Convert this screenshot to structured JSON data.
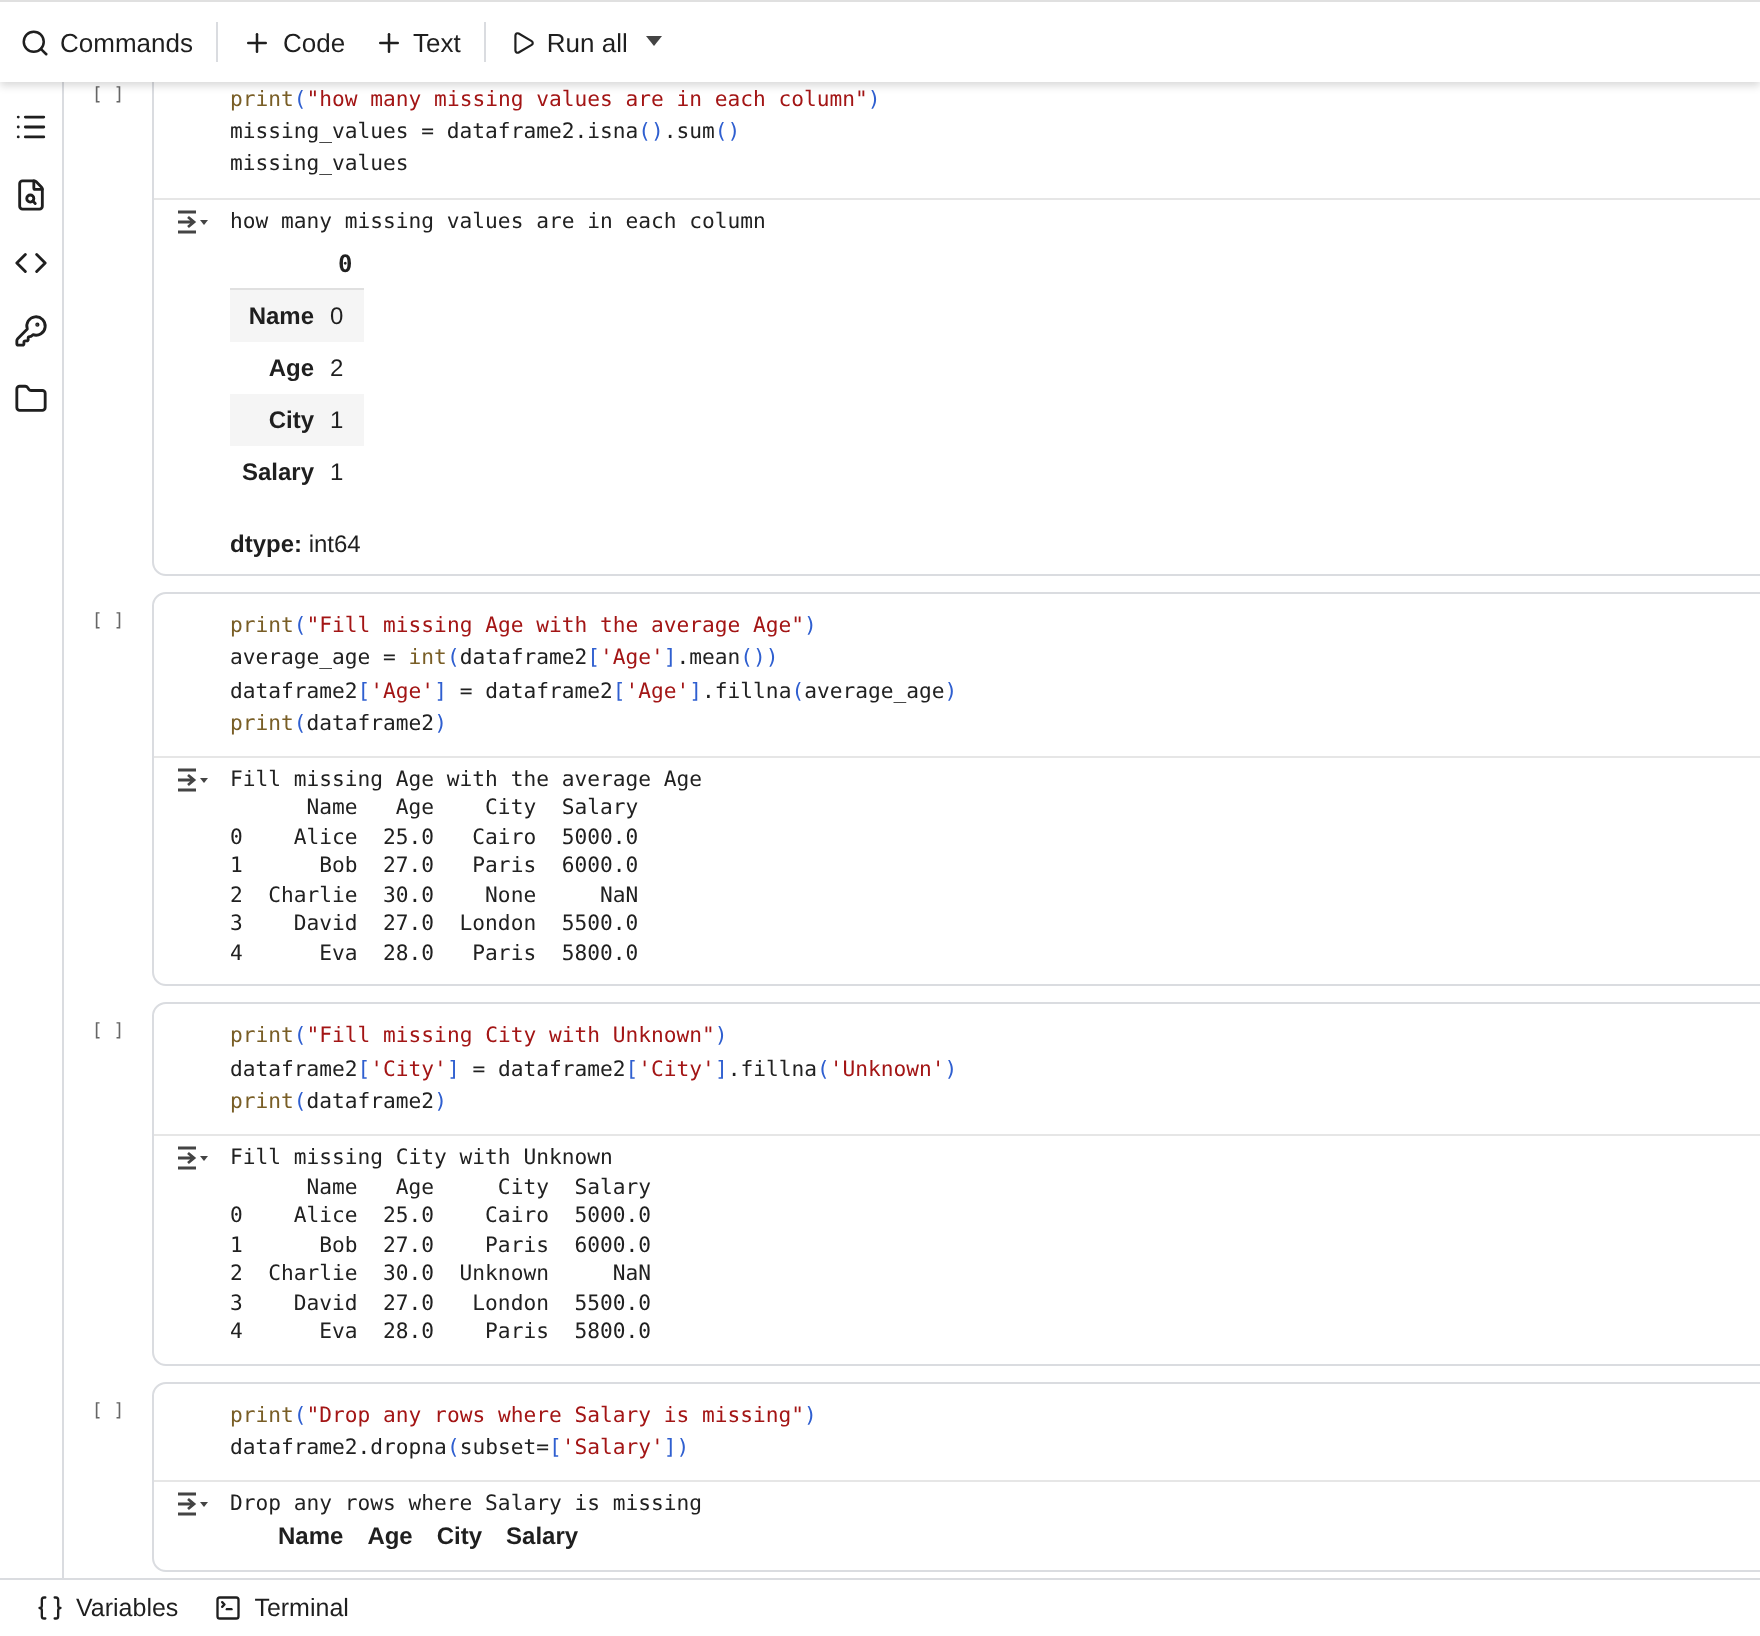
{
  "toolbar": {
    "items": [
      {
        "kind": "search",
        "label": "Commands"
      },
      {
        "kind": "add",
        "label": "Code"
      },
      {
        "kind": "add",
        "label": "Text"
      },
      {
        "kind": "run",
        "label": "Run all"
      }
    ]
  },
  "cells": [
    {
      "bracket": "[ ]",
      "code": [
        [
          {
            "kind": "fn",
            "text": "print"
          },
          {
            "kind": "br",
            "text": "("
          },
          {
            "kind": "str",
            "text": "\"how many missing values are in each column\""
          },
          {
            "kind": "br",
            "text": ")"
          }
        ],
        [
          {
            "kind": "plain",
            "text": "missing_values = dataframe2.isna"
          },
          {
            "kind": "br",
            "text": "()"
          },
          {
            "kind": "plain",
            "text": ".sum"
          },
          {
            "kind": "br",
            "text": "()"
          }
        ],
        [
          {
            "kind": "plain",
            "text": "missing_values"
          }
        ]
      ],
      "output": {
        "kind": "series",
        "lines": [
          "how many missing values are in each column"
        ],
        "header": "0",
        "rows": [
          {
            "label": "Name",
            "value": "0"
          },
          {
            "label": "Age",
            "value": "2"
          },
          {
            "label": "City",
            "value": "1"
          },
          {
            "label": "Salary",
            "value": "1"
          }
        ],
        "dtype": "**dtype:** int64"
      }
    },
    {
      "bracket": "[ ]",
      "code": [
        [
          {
            "kind": "fn",
            "text": "print"
          },
          {
            "kind": "br",
            "text": "("
          },
          {
            "kind": "str",
            "text": "\"Fill missing Age with the average Age\""
          },
          {
            "kind": "br",
            "text": ")"
          }
        ],
        [
          {
            "kind": "plain",
            "text": "average_age = "
          },
          {
            "kind": "fn",
            "text": "int"
          },
          {
            "kind": "br",
            "text": "("
          },
          {
            "kind": "plain",
            "text": "dataframe2"
          },
          {
            "kind": "br",
            "text": "["
          },
          {
            "kind": "str",
            "text": "'Age'"
          },
          {
            "kind": "br",
            "text": "]"
          },
          {
            "kind": "plain",
            "text": ".mean"
          },
          {
            "kind": "br",
            "text": "())"
          }
        ],
        [
          {
            "kind": "plain",
            "text": "dataframe2"
          },
          {
            "kind": "br",
            "text": "["
          },
          {
            "kind": "str",
            "text": "'Age'"
          },
          {
            "kind": "br",
            "text": "]"
          },
          {
            "kind": "plain",
            "text": " = dataframe2"
          },
          {
            "kind": "br",
            "text": "["
          },
          {
            "kind": "str",
            "text": "'Age'"
          },
          {
            "kind": "br",
            "text": "]"
          },
          {
            "kind": "plain",
            "text": ".fillna"
          },
          {
            "kind": "br",
            "text": "("
          },
          {
            "kind": "plain",
            "text": "average_age"
          },
          {
            "kind": "br",
            "text": ")"
          }
        ],
        [
          {
            "kind": "fn",
            "text": "print"
          },
          {
            "kind": "br",
            "text": "("
          },
          {
            "kind": "plain",
            "text": "dataframe2"
          },
          {
            "kind": "br",
            "text": ")"
          }
        ]
      ],
      "output": {
        "kind": "text",
        "lines": [
          "Fill missing Age with the average Age",
          "      Name   Age    City  Salary",
          "0    Alice  25.0   Cairo  5000.0",
          "1      Bob  27.0   Paris  6000.0",
          "2  Charlie  30.0    None     NaN",
          "3    David  27.0  London  5500.0",
          "4      Eva  28.0   Paris  5800.0"
        ]
      }
    },
    {
      "bracket": "[ ]",
      "code": [
        [
          {
            "kind": "fn",
            "text": "print"
          },
          {
            "kind": "br",
            "text": "("
          },
          {
            "kind": "str",
            "text": "\"Fill missing City with Unknown\""
          },
          {
            "kind": "br",
            "text": ")"
          }
        ],
        [
          {
            "kind": "plain",
            "text": "dataframe2"
          },
          {
            "kind": "br",
            "text": "["
          },
          {
            "kind": "str",
            "text": "'City'"
          },
          {
            "kind": "br",
            "text": "]"
          },
          {
            "kind": "plain",
            "text": " = dataframe2"
          },
          {
            "kind": "br",
            "text": "["
          },
          {
            "kind": "str",
            "text": "'City'"
          },
          {
            "kind": "br",
            "text": "]"
          },
          {
            "kind": "plain",
            "text": ".fillna"
          },
          {
            "kind": "br",
            "text": "("
          },
          {
            "kind": "str",
            "text": "'Unknown'"
          },
          {
            "kind": "br",
            "text": ")"
          }
        ],
        [
          {
            "kind": "fn",
            "text": "print"
          },
          {
            "kind": "br",
            "text": "("
          },
          {
            "kind": "plain",
            "text": "dataframe2"
          },
          {
            "kind": "br",
            "text": ")"
          }
        ]
      ],
      "output": {
        "kind": "text",
        "lines": [
          "Fill missing City with Unknown",
          "      Name   Age     City  Salary",
          "0    Alice  25.0    Cairo  5000.0",
          "1      Bob  27.0    Paris  6000.0",
          "2  Charlie  30.0  Unknown     NaN",
          "3    David  27.0   London  5500.0",
          "4      Eva  28.0    Paris  5800.0"
        ]
      }
    },
    {
      "bracket": "[ ]",
      "code": [
        [
          {
            "kind": "fn",
            "text": "print"
          },
          {
            "kind": "br",
            "text": "("
          },
          {
            "kind": "str",
            "text": "\"Drop any rows where Salary is missing\""
          },
          {
            "kind": "br",
            "text": ")"
          }
        ],
        [
          {
            "kind": "plain",
            "text": "dataframe2.dropna"
          },
          {
            "kind": "br",
            "text": "("
          },
          {
            "kind": "plain",
            "text": "subset="
          },
          {
            "kind": "br",
            "text": "["
          },
          {
            "kind": "str",
            "text": "'Salary'"
          },
          {
            "kind": "br",
            "text": "])"
          }
        ]
      ],
      "output": {
        "kind": "table",
        "lines": [
          "Drop any rows where Salary is missing"
        ],
        "columns": [
          "Name",
          "Age",
          "City",
          "Salary"
        ]
      }
    }
  ],
  "bottom_bar": {
    "items": [
      {
        "kind": "variables",
        "label": "Variables"
      },
      {
        "kind": "terminal",
        "label": "Terminal"
      }
    ]
  }
}
